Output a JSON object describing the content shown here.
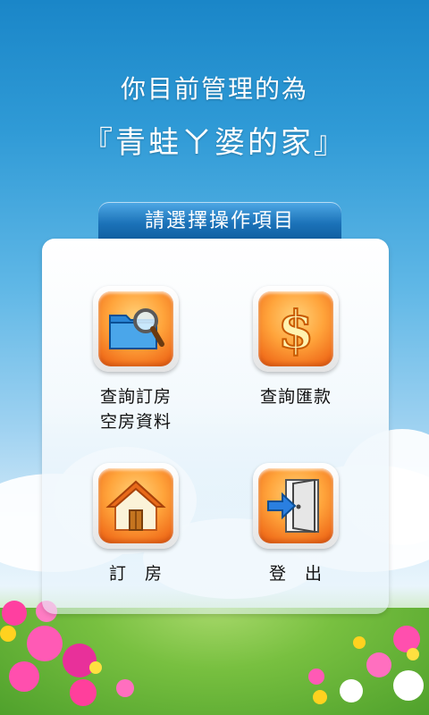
{
  "header": {
    "line1": "你目前管理的為",
    "line2": "『青蛙ㄚ婆的家』"
  },
  "section_title": "請選擇操作項目",
  "menu": {
    "query_rooms": {
      "label_line1": "查詢訂房",
      "label_line2": "空房資料",
      "icon": "folder-search-icon"
    },
    "query_payment": {
      "label": "查詢匯款",
      "icon": "dollar-icon"
    },
    "book": {
      "label": "訂　房",
      "icon": "house-icon"
    },
    "logout": {
      "label": "登　出",
      "icon": "exit-door-icon"
    }
  },
  "colors": {
    "sky_top": "#1a86c8",
    "tab_blue": "#1b72b8",
    "icon_orange": "#f2731e"
  }
}
